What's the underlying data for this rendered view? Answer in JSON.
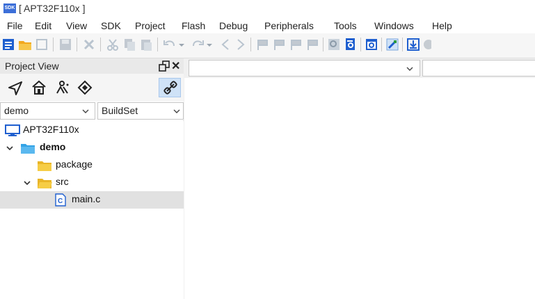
{
  "window": {
    "title": "[ APT32F110x ]",
    "icon": "sdk-app-icon",
    "icon_text": "SDK"
  },
  "menubar": {
    "items": [
      "File",
      "Edit",
      "View",
      "SDK",
      "Project",
      "Flash",
      "Debug",
      "Peripherals",
      "Tools",
      "Windows",
      "Help"
    ]
  },
  "project_view": {
    "title": "Project View",
    "project_dropdown": "demo",
    "buildset_dropdown": "BuildSet",
    "view_icons": [
      "navigate-icon",
      "home-icon",
      "chip-icon",
      "diamond-icon",
      "link-icon"
    ],
    "tree": [
      {
        "label": "APT32F110x",
        "icon": "computer-icon",
        "bold": false,
        "expanded": null
      },
      {
        "label": "demo",
        "icon": "folder-icon",
        "bold": true,
        "expanded": true
      },
      {
        "label": "package",
        "icon": "folder-icon",
        "bold": false,
        "expanded": null
      },
      {
        "label": "src",
        "icon": "folder-open-icon",
        "bold": false,
        "expanded": true
      },
      {
        "label": "main.c",
        "icon": "c-file-icon",
        "bold": false,
        "expanded": null,
        "selected": true
      }
    ]
  },
  "colors": {
    "accent": "#2f6fd6",
    "folder": "#f2c230",
    "selected_row": "#e1e1e1",
    "active_tool": "#cfe2f7"
  }
}
